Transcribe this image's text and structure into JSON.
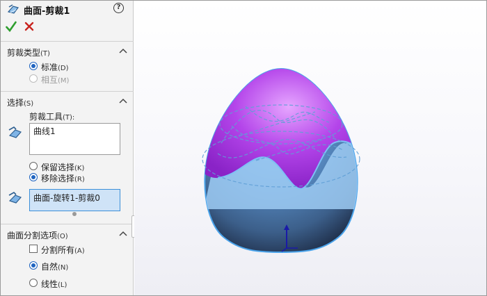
{
  "header": {
    "title": "曲面-剪裁1",
    "help_label": "?"
  },
  "trim_type": {
    "title": "剪裁类型",
    "hotkey": "(T)",
    "options": [
      {
        "label": "标准",
        "hotkey": "(D)",
        "selected": true,
        "disabled": false
      },
      {
        "label": "相互",
        "hotkey": "(M)",
        "selected": false,
        "disabled": true
      }
    ]
  },
  "selections": {
    "title": "选择",
    "hotkey": "(S)",
    "trim_tool_label": "剪裁工具",
    "trim_tool_hotkey": "(T):",
    "trim_tool_value": "曲线1",
    "keep_remove": [
      {
        "label": "保留选择",
        "hotkey": "(K)",
        "selected": false
      },
      {
        "label": "移除选择",
        "hotkey": "(R)",
        "selected": true
      }
    ],
    "pieces_value": "曲面-旋转1-剪裁0"
  },
  "split_options": {
    "title": "曲面分割选项",
    "hotkey": "(O)",
    "split_all_label": "分割所有",
    "split_all_hotkey": "(A)",
    "split_all_checked": false,
    "options": [
      {
        "label": "自然",
        "hotkey": "(N)",
        "selected": true
      },
      {
        "label": "线性",
        "hotkey": "(L)",
        "selected": false
      }
    ]
  },
  "colors": {
    "accept": "#2e9e2e",
    "cancel": "#c8231e",
    "surface_upper": "#b445ea",
    "surface_lower": "#5c9ad8",
    "edge": "#4aa3ea",
    "selection_fill": "#cfe3f7"
  },
  "icons": {
    "feature": "surface-trim-icon",
    "ok": "check-icon",
    "cancel": "close-icon",
    "tool_selector": "surface-selector-icon",
    "pieces_selector": "surface-selector-icon",
    "collapse": "chevron-up-icon",
    "triad": "axis-triad-icon"
  }
}
